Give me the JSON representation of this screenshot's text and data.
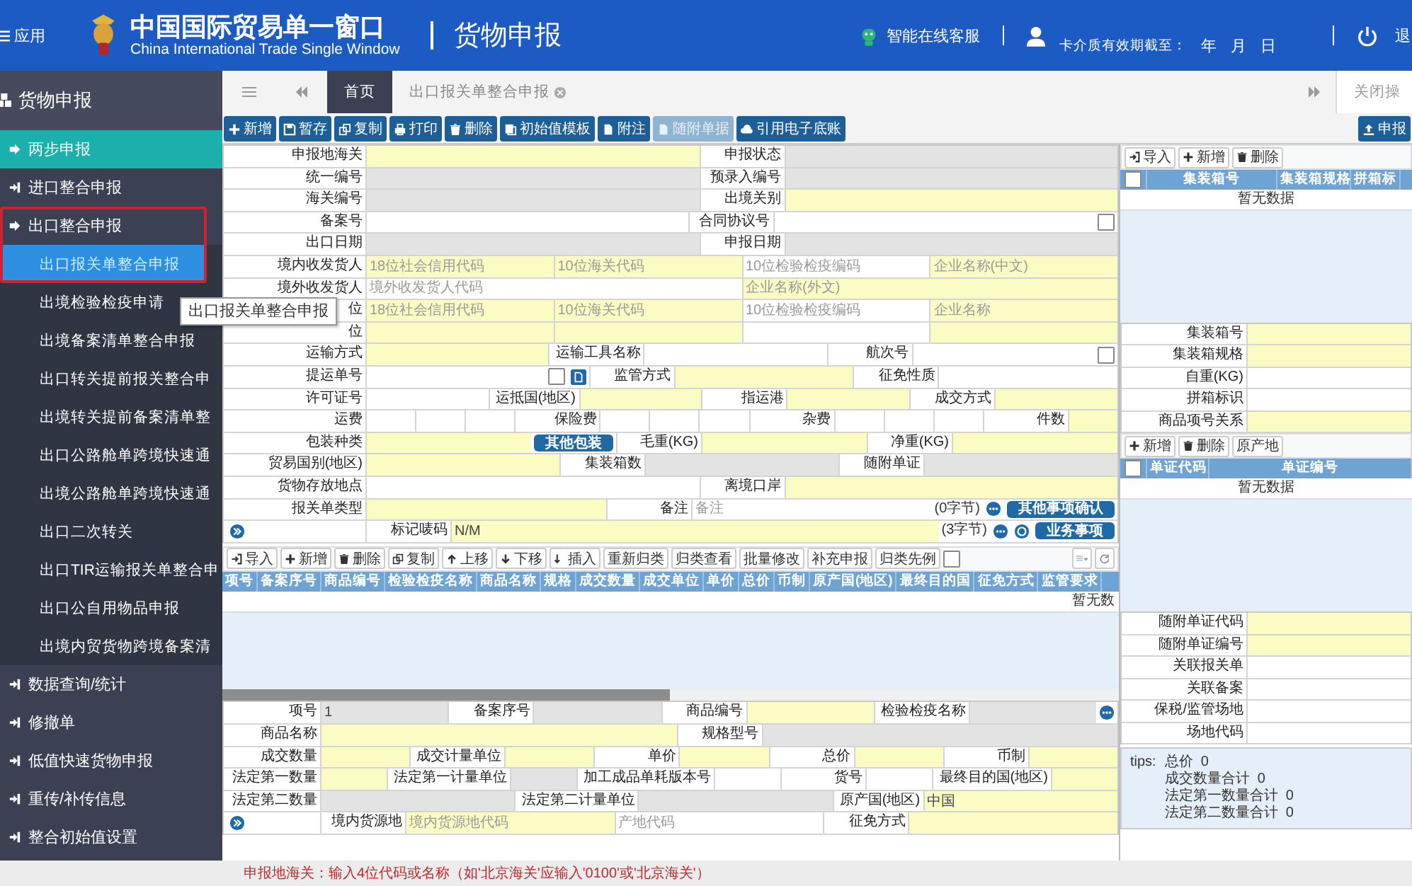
{
  "header": {
    "apps_label": "应用",
    "title": "中国国际贸易单一窗口",
    "subtitle": "China International Trade Single Window",
    "module": "货物申报",
    "service": "智能在线客服",
    "card_expiry": "卡介质有效期截至：",
    "year": "年",
    "month": "月",
    "day": "日",
    "logout": "退"
  },
  "sidebar": {
    "title": "货物申报",
    "items": [
      {
        "kind": "featured",
        "label": "两步申报"
      },
      {
        "kind": "group",
        "label": "进口整合申报",
        "expanded": false,
        "annotated": false
      },
      {
        "kind": "group",
        "label": "出口整合申报",
        "expanded": true,
        "annotated": true,
        "children": [
          {
            "label": "出口报关单整合申报",
            "selected": true
          },
          {
            "label": "出境检验检疫申请",
            "selected": false
          },
          {
            "label": "出境备案清单整合申报",
            "selected": false
          },
          {
            "label": "出口转关提前报关整合申",
            "selected": false
          },
          {
            "label": "出境转关提前备案清单整",
            "selected": false
          },
          {
            "label": "出口公路舱单跨境快速通",
            "selected": false
          },
          {
            "label": "出境公路舱单跨境快速通",
            "selected": false
          },
          {
            "label": "出口二次转关",
            "selected": false
          },
          {
            "label": "出口TIR运输报关单整合申",
            "selected": false
          },
          {
            "label": "出口公自用物品申报",
            "selected": false
          },
          {
            "label": "出境内贸货物跨境备案清",
            "selected": false
          }
        ]
      },
      {
        "kind": "group",
        "label": "数据查询/统计",
        "expanded": false,
        "annotated": false
      },
      {
        "kind": "group",
        "label": "修撤单",
        "expanded": false,
        "annotated": false
      },
      {
        "kind": "group",
        "label": "低值快速货物申报",
        "expanded": false,
        "annotated": false
      },
      {
        "kind": "group",
        "label": "重传/补传信息",
        "expanded": false,
        "annotated": false
      },
      {
        "kind": "group",
        "label": "整合初始值设置",
        "expanded": false,
        "annotated": false
      }
    ]
  },
  "tooltip": {
    "text": "出口报关单整合申报"
  },
  "tabs": [
    {
      "label": "首页",
      "selected": true,
      "closable": false
    },
    {
      "label": "出口报关单整合申报",
      "selected": false,
      "closable": true
    }
  ],
  "close_actions": "关闭操",
  "toolbar": [
    {
      "label": "新增",
      "disabled": false
    },
    {
      "label": "暂存",
      "disabled": false
    },
    {
      "label": "复制",
      "disabled": false
    },
    {
      "label": "打印",
      "disabled": false
    },
    {
      "label": "删除",
      "disabled": false
    },
    {
      "label": "初始值模板",
      "disabled": false
    },
    {
      "label": "附注",
      "disabled": false
    },
    {
      "label": "随附单据",
      "disabled": true
    },
    {
      "label": "引用电子底账",
      "disabled": false
    }
  ],
  "submit_button": "申报",
  "form": [
    [
      {
        "kind": "label",
        "text": "申报地海关"
      },
      {
        "kind": "required-field"
      },
      {
        "kind": "label",
        "text": "申报状态"
      },
      {
        "kind": "readonly-field"
      }
    ],
    [
      {
        "kind": "label",
        "text": "统一编号"
      },
      {
        "kind": "readonly-field"
      },
      {
        "kind": "label",
        "text": "预录入编号"
      },
      {
        "kind": "readonly-field"
      }
    ],
    [
      {
        "kind": "label",
        "text": "海关编号"
      },
      {
        "kind": "readonly-field"
      },
      {
        "kind": "label",
        "text": "出境关别"
      },
      {
        "kind": "required-field"
      }
    ],
    [
      {
        "kind": "label",
        "text": "备案号"
      },
      {
        "kind": "field"
      },
      {
        "kind": "label",
        "text": "合同协议号"
      },
      {
        "kind": "field"
      },
      {
        "kind": "checkbox",
        "checked": false
      }
    ],
    [
      {
        "kind": "label",
        "text": "出口日期"
      },
      {
        "kind": "readonly-field"
      },
      {
        "kind": "label",
        "text": "申报日期"
      },
      {
        "kind": "readonly-field"
      }
    ],
    [
      {
        "kind": "label",
        "text": "境内收发货人"
      },
      {
        "kind": "required-field",
        "placeholder": "18位社会信用代码"
      },
      {
        "kind": "required-field",
        "placeholder": "10位海关代码"
      },
      {
        "kind": "field",
        "placeholder": "10位检验检疫编码"
      },
      {
        "kind": "required-field",
        "placeholder": "企业名称(中文)"
      }
    ],
    [
      {
        "kind": "label",
        "text": "境外收发货人"
      },
      {
        "kind": "field",
        "placeholder": "境外收发货人代码"
      },
      {
        "kind": "required-field",
        "placeholder": "企业名称(外文)"
      }
    ],
    [
      {
        "kind": "label",
        "text": "位"
      },
      {
        "kind": "required-field",
        "placeholder": "18位社会信用代码"
      },
      {
        "kind": "required-field",
        "placeholder": "10位海关代码"
      },
      {
        "kind": "field",
        "placeholder": "10位检验检疫编码"
      },
      {
        "kind": "required-field",
        "placeholder": "企业名称"
      }
    ],
    [
      {
        "kind": "label",
        "text": "位"
      },
      {
        "kind": "required-field"
      },
      {
        "kind": "required-field"
      },
      {
        "kind": "field"
      },
      {
        "kind": "required-field"
      }
    ],
    [
      {
        "kind": "label",
        "text": "运输方式"
      },
      {
        "kind": "required-field"
      },
      {
        "kind": "label",
        "text": "运输工具名称"
      },
      {
        "kind": "field"
      },
      {
        "kind": "label",
        "text": "航次号"
      },
      {
        "kind": "field"
      },
      {
        "kind": "checkbox",
        "checked": false
      }
    ],
    [
      {
        "kind": "label",
        "text": "提运单号"
      },
      {
        "kind": "field"
      },
      {
        "kind": "checkbox",
        "checked": false
      },
      {
        "kind": "attach-button"
      },
      {
        "kind": "label",
        "text": "监管方式"
      },
      {
        "kind": "required-field"
      },
      {
        "kind": "label",
        "text": "征免性质"
      },
      {
        "kind": "field"
      }
    ],
    [
      {
        "kind": "label",
        "text": "许可证号"
      },
      {
        "kind": "field"
      },
      {
        "kind": "label",
        "text": "运抵国(地区)"
      },
      {
        "kind": "required-field"
      },
      {
        "kind": "label",
        "text": "指运港"
      },
      {
        "kind": "required-field"
      },
      {
        "kind": "label",
        "text": "成交方式"
      },
      {
        "kind": "required-field"
      }
    ],
    [
      {
        "kind": "label",
        "text": "运费"
      },
      {
        "kind": "field"
      },
      {
        "kind": "field"
      },
      {
        "kind": "field"
      },
      {
        "kind": "label",
        "text": "保险费"
      },
      {
        "kind": "field"
      },
      {
        "kind": "field"
      },
      {
        "kind": "field"
      },
      {
        "kind": "label",
        "text": "杂费"
      },
      {
        "kind": "field"
      },
      {
        "kind": "field"
      },
      {
        "kind": "field"
      },
      {
        "kind": "label",
        "text": "件数"
      },
      {
        "kind": "required-field"
      }
    ],
    [
      {
        "kind": "label",
        "text": "包装种类"
      },
      {
        "kind": "required-field"
      },
      {
        "kind": "button",
        "text": "其他包装"
      },
      {
        "kind": "label",
        "text": "毛重(KG)"
      },
      {
        "kind": "required-field"
      },
      {
        "kind": "label",
        "text": "净重(KG)"
      },
      {
        "kind": "required-field"
      }
    ],
    [
      {
        "kind": "label",
        "text": "贸易国别(地区)"
      },
      {
        "kind": "required-field"
      },
      {
        "kind": "label",
        "text": "集装箱数"
      },
      {
        "kind": "readonly-field"
      },
      {
        "kind": "label",
        "text": "随附单证"
      },
      {
        "kind": "readonly-field"
      }
    ],
    [
      {
        "kind": "label",
        "text": "货物存放地点"
      },
      {
        "kind": "field"
      },
      {
        "kind": "label",
        "text": "离境口岸"
      },
      {
        "kind": "required-field"
      }
    ],
    [
      {
        "kind": "label",
        "text": "报关单类型"
      },
      {
        "kind": "required-field"
      },
      {
        "kind": "label",
        "text": "备注"
      },
      {
        "kind": "field",
        "placeholder": "备注"
      },
      {
        "kind": "note",
        "text": "(0字节)"
      },
      {
        "kind": "more-button"
      },
      {
        "kind": "button",
        "text": "其他事项确认"
      }
    ],
    [
      {
        "kind": "expand-button"
      },
      {
        "kind": "label",
        "text": "标记唛码"
      },
      {
        "kind": "required-field",
        "value": "N/M"
      },
      {
        "kind": "note",
        "text": "(3字节)"
      },
      {
        "kind": "more-button"
      },
      {
        "kind": "help-button"
      },
      {
        "kind": "button",
        "text": "业务事项"
      }
    ]
  ],
  "goods": {
    "toolbar": [
      {
        "label": "导入"
      },
      {
        "label": "新增"
      },
      {
        "label": "删除"
      },
      {
        "label": "复制"
      },
      {
        "label": "上移"
      },
      {
        "label": "下移"
      },
      {
        "label": "插入"
      },
      {
        "label": "重新归类"
      },
      {
        "label": "归类查看"
      },
      {
        "label": "批量修改"
      },
      {
        "label": "补充申报"
      },
      {
        "label": "归类先例"
      }
    ],
    "select_all": {
      "checked": false
    },
    "columns": [
      "项号",
      "备案序号",
      "商品编号",
      "检验检疫名称",
      "商品名称",
      "规格",
      "成交数量",
      "成交单位",
      "单价",
      "总价",
      "币制",
      "原产国(地区)",
      "最终目的国",
      "征免方式",
      "监管要求"
    ],
    "empty_text": "暂无数",
    "form": [
      [
        {
          "kind": "label",
          "text": "项号"
        },
        {
          "kind": "readonly-field",
          "value": "1"
        },
        {
          "kind": "label",
          "text": "备案序号"
        },
        {
          "kind": "readonly-field"
        },
        {
          "kind": "label",
          "text": "商品编号"
        },
        {
          "kind": "required-field"
        },
        {
          "kind": "label",
          "text": "检验检疫名称"
        },
        {
          "kind": "readonly-field"
        },
        {
          "kind": "more-button"
        }
      ],
      [
        {
          "kind": "label",
          "text": "商品名称"
        },
        {
          "kind": "required-field"
        },
        {
          "kind": "label",
          "text": "规格型号"
        },
        {
          "kind": "readonly-field"
        }
      ],
      [
        {
          "kind": "label",
          "text": "成交数量"
        },
        {
          "kind": "required-field"
        },
        {
          "kind": "label",
          "text": "成交计量单位"
        },
        {
          "kind": "required-field"
        },
        {
          "kind": "label",
          "text": "单价"
        },
        {
          "kind": "required-field"
        },
        {
          "kind": "label",
          "text": "总价"
        },
        {
          "kind": "required-field"
        },
        {
          "kind": "label",
          "text": "币制"
        },
        {
          "kind": "required-field"
        }
      ],
      [
        {
          "kind": "label",
          "text": "法定第一数量"
        },
        {
          "kind": "required-field"
        },
        {
          "kind": "label",
          "text": "法定第一计量单位"
        },
        {
          "kind": "readonly-field"
        },
        {
          "kind": "label",
          "text": "加工成品单耗版本号"
        },
        {
          "kind": "field"
        },
        {
          "kind": "label",
          "text": "货号"
        },
        {
          "kind": "field"
        },
        {
          "kind": "label",
          "text": "最终目的国(地区)"
        },
        {
          "kind": "required-field"
        }
      ],
      [
        {
          "kind": "label",
          "text": "法定第二数量"
        },
        {
          "kind": "readonly-field"
        },
        {
          "kind": "label",
          "text": "法定第二计量单位"
        },
        {
          "kind": "readonly-field"
        },
        {
          "kind": "label",
          "text": "原产国(地区)"
        },
        {
          "kind": "required-field",
          "value": "中国"
        }
      ],
      [
        {
          "kind": "expand-button"
        },
        {
          "kind": "label",
          "text": "境内货源地"
        },
        {
          "kind": "required-field",
          "placeholder": "境内货源地代码"
        },
        {
          "kind": "field",
          "placeholder": "产地代码"
        },
        {
          "kind": "label",
          "text": "征免方式"
        },
        {
          "kind": "required-field"
        }
      ]
    ]
  },
  "containers": {
    "toolbar": [
      {
        "label": "导入"
      },
      {
        "label": "新增"
      },
      {
        "label": "删除"
      }
    ],
    "select_all": {
      "checked": false
    },
    "columns": [
      "集装箱号",
      "集装箱规格",
      "拼箱标"
    ],
    "empty_text": "暂无数据",
    "form": [
      [
        {
          "kind": "label",
          "text": "集装箱号"
        },
        {
          "kind": "required-field"
        }
      ],
      [
        {
          "kind": "label",
          "text": "集装箱规格"
        },
        {
          "kind": "required-field"
        }
      ],
      [
        {
          "kind": "label",
          "text": "自重(KG)"
        },
        {
          "kind": "field"
        }
      ],
      [
        {
          "kind": "label",
          "text": "拼箱标识"
        },
        {
          "kind": "field"
        }
      ],
      [
        {
          "kind": "label",
          "text": "商品项号关系"
        },
        {
          "kind": "required-field"
        }
      ]
    ]
  },
  "documents": {
    "toolbar": [
      {
        "label": "新增"
      },
      {
        "label": "删除"
      },
      {
        "label": "原产地"
      }
    ],
    "select_all": {
      "checked": false
    },
    "columns": [
      "单证代码",
      "单证编号"
    ],
    "empty_text": "暂无数据",
    "form": [
      [
        {
          "kind": "label",
          "text": "随附单证代码"
        },
        {
          "kind": "required-field"
        }
      ],
      [
        {
          "kind": "label",
          "text": "随附单证编号"
        },
        {
          "kind": "required-field"
        }
      ],
      [
        {
          "kind": "label",
          "text": "关联报关单"
        },
        {
          "kind": "field"
        }
      ],
      [
        {
          "kind": "label",
          "text": "关联备案"
        },
        {
          "kind": "field"
        }
      ],
      [
        {
          "kind": "label",
          "text": "保税/监管场地"
        },
        {
          "kind": "field"
        }
      ],
      [
        {
          "kind": "label",
          "text": "场地代码"
        },
        {
          "kind": "field"
        }
      ]
    ]
  },
  "tips": {
    "label": "tips:",
    "lines": [
      "总价  0",
      "成交数量合计  0",
      "法定第一数量合计  0",
      "法定第二数量合计  0"
    ]
  },
  "hint": "申报地海关：输入4位代码或名称（如'北京海关'应输入'0100'或'北京海关'）"
}
